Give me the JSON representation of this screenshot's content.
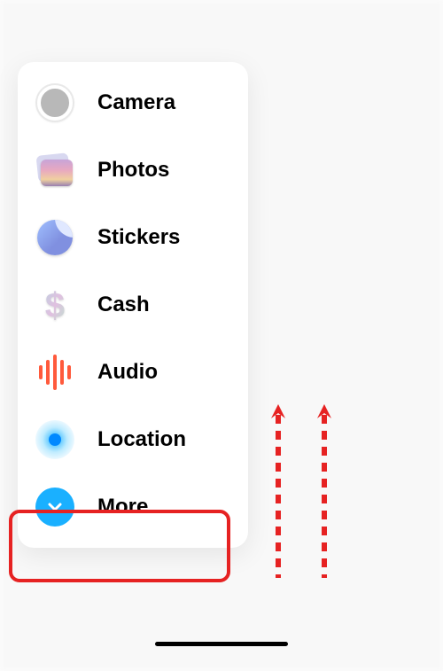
{
  "menu": {
    "items": [
      {
        "icon": "camera",
        "label": "Camera"
      },
      {
        "icon": "photos",
        "label": "Photos"
      },
      {
        "icon": "stickers",
        "label": "Stickers"
      },
      {
        "icon": "cash",
        "label": "Cash"
      },
      {
        "icon": "audio",
        "label": "Audio"
      },
      {
        "icon": "location",
        "label": "Location"
      },
      {
        "icon": "more",
        "label": "More"
      }
    ]
  },
  "annotation": {
    "highlighted_item": "More",
    "arrow_direction": "up",
    "colors": {
      "highlight": "#e62222",
      "arrow": "#e62222"
    }
  }
}
